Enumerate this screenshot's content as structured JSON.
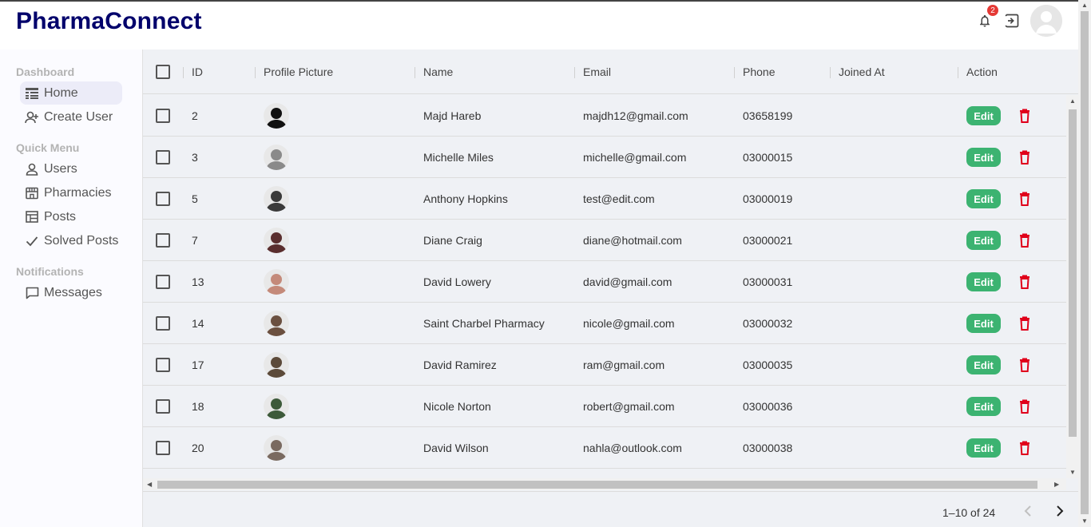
{
  "app": {
    "title": "PharmaConnect",
    "notification_count": "2"
  },
  "sidebar": {
    "sections": [
      {
        "title": "Dashboard",
        "items": [
          {
            "label": "Home",
            "icon": "home-table-icon",
            "active": true
          },
          {
            "label": "Create User",
            "icon": "person-add-icon"
          }
        ]
      },
      {
        "title": "Quick Menu",
        "items": [
          {
            "label": "Users",
            "icon": "person-icon"
          },
          {
            "label": "Pharmacies",
            "icon": "store-icon"
          },
          {
            "label": "Posts",
            "icon": "posts-icon"
          },
          {
            "label": "Solved Posts",
            "icon": "check-icon"
          }
        ]
      },
      {
        "title": "Notifications",
        "items": [
          {
            "label": "Messages",
            "icon": "chat-bubble-icon"
          }
        ]
      }
    ]
  },
  "table": {
    "headers": {
      "id": "ID",
      "profile_picture": "Profile Picture",
      "name": "Name",
      "email": "Email",
      "phone": "Phone",
      "joined_at": "Joined At",
      "action": "Action"
    },
    "edit_label": "Edit",
    "rows": [
      {
        "id": "2",
        "name": "Majd Hareb",
        "email": "majdh12@gmail.com",
        "phone": "03658199",
        "joined_at": "",
        "avatar_color": "#111111"
      },
      {
        "id": "3",
        "name": "Michelle Miles",
        "email": "michelle@gmail.com",
        "phone": "03000015",
        "joined_at": "",
        "avatar_color": "#8a8a8a"
      },
      {
        "id": "5",
        "name": "Anthony Hopkins",
        "email": "test@edit.com",
        "phone": "03000019",
        "joined_at": "",
        "avatar_color": "#3a3a3a"
      },
      {
        "id": "7",
        "name": "Diane Craig",
        "email": "diane@hotmail.com",
        "phone": "03000021",
        "joined_at": "",
        "avatar_color": "#5a2e2e"
      },
      {
        "id": "13",
        "name": "David Lowery",
        "email": "david@gmail.com",
        "phone": "03000031",
        "joined_at": "",
        "avatar_color": "#c48a7a"
      },
      {
        "id": "14",
        "name": "Saint Charbel Pharmacy",
        "email": "nicole@gmail.com",
        "phone": "03000032",
        "joined_at": "",
        "avatar_color": "#6b5040"
      },
      {
        "id": "17",
        "name": "David Ramirez",
        "email": "ram@gmail.com",
        "phone": "03000035",
        "joined_at": "",
        "avatar_color": "#5c4a3a"
      },
      {
        "id": "18",
        "name": "Nicole Norton",
        "email": "robert@gmail.com",
        "phone": "03000036",
        "joined_at": "",
        "avatar_color": "#3d5a3a"
      },
      {
        "id": "20",
        "name": "David Wilson",
        "email": "nahla@outlook.com",
        "phone": "03000038",
        "joined_at": "",
        "avatar_color": "#7a6a60"
      }
    ]
  },
  "pagination": {
    "text": "1–10 of 24"
  },
  "colors": {
    "brand": "#00006b",
    "edit": "#3cb371",
    "delete": "#e0001b",
    "badge": "#e53935"
  }
}
